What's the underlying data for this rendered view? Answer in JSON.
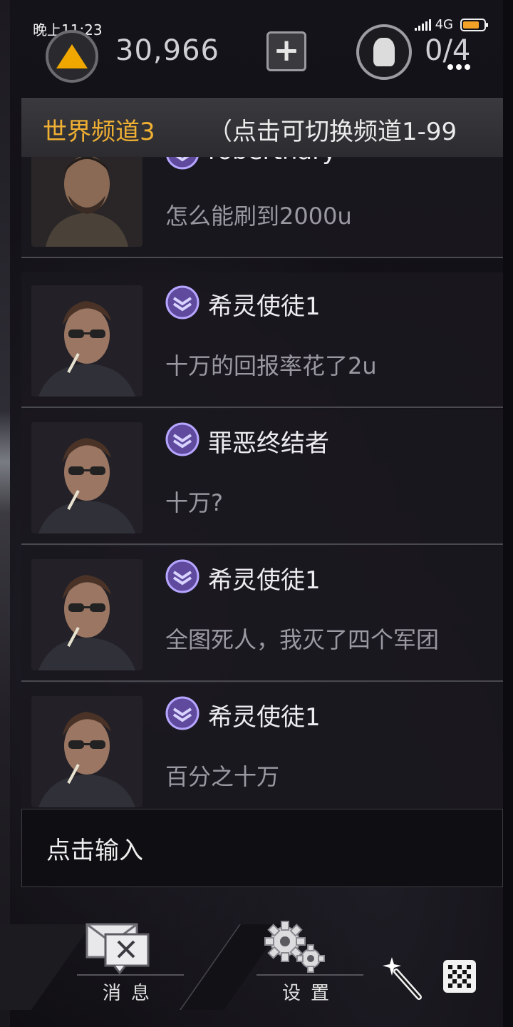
{
  "status_bar": {
    "time": "晚上11:23",
    "network": "4G"
  },
  "hud": {
    "coin_amount": "30,966",
    "add_label": "+",
    "stamina_amount": "0/4"
  },
  "channel": {
    "name": "世界频道3",
    "hint": "（点击可切换频道1-99"
  },
  "messages": [
    {
      "username": "roberthary",
      "text": "怎么能刷到2000u",
      "avatar": "bearded"
    },
    {
      "username": "希灵使徒1",
      "text": "十万的回报率花了2u",
      "avatar": "sunglasses"
    },
    {
      "username": "罪恶终结者",
      "text": "十万?",
      "avatar": "sunglasses"
    },
    {
      "username": "希灵使徒1",
      "text": "全图死人，我灭了四个军团",
      "avatar": "sunglasses"
    },
    {
      "username": "希灵使徒1",
      "text": "百分之十万",
      "avatar": "sunglasses"
    }
  ],
  "input": {
    "placeholder": "点击输入"
  },
  "nav": {
    "messages_label": "消息",
    "settings_label": "设置"
  },
  "colors": {
    "channel_name": "#f0b033",
    "coin": "#f0a800",
    "battery": "#f4a227"
  }
}
